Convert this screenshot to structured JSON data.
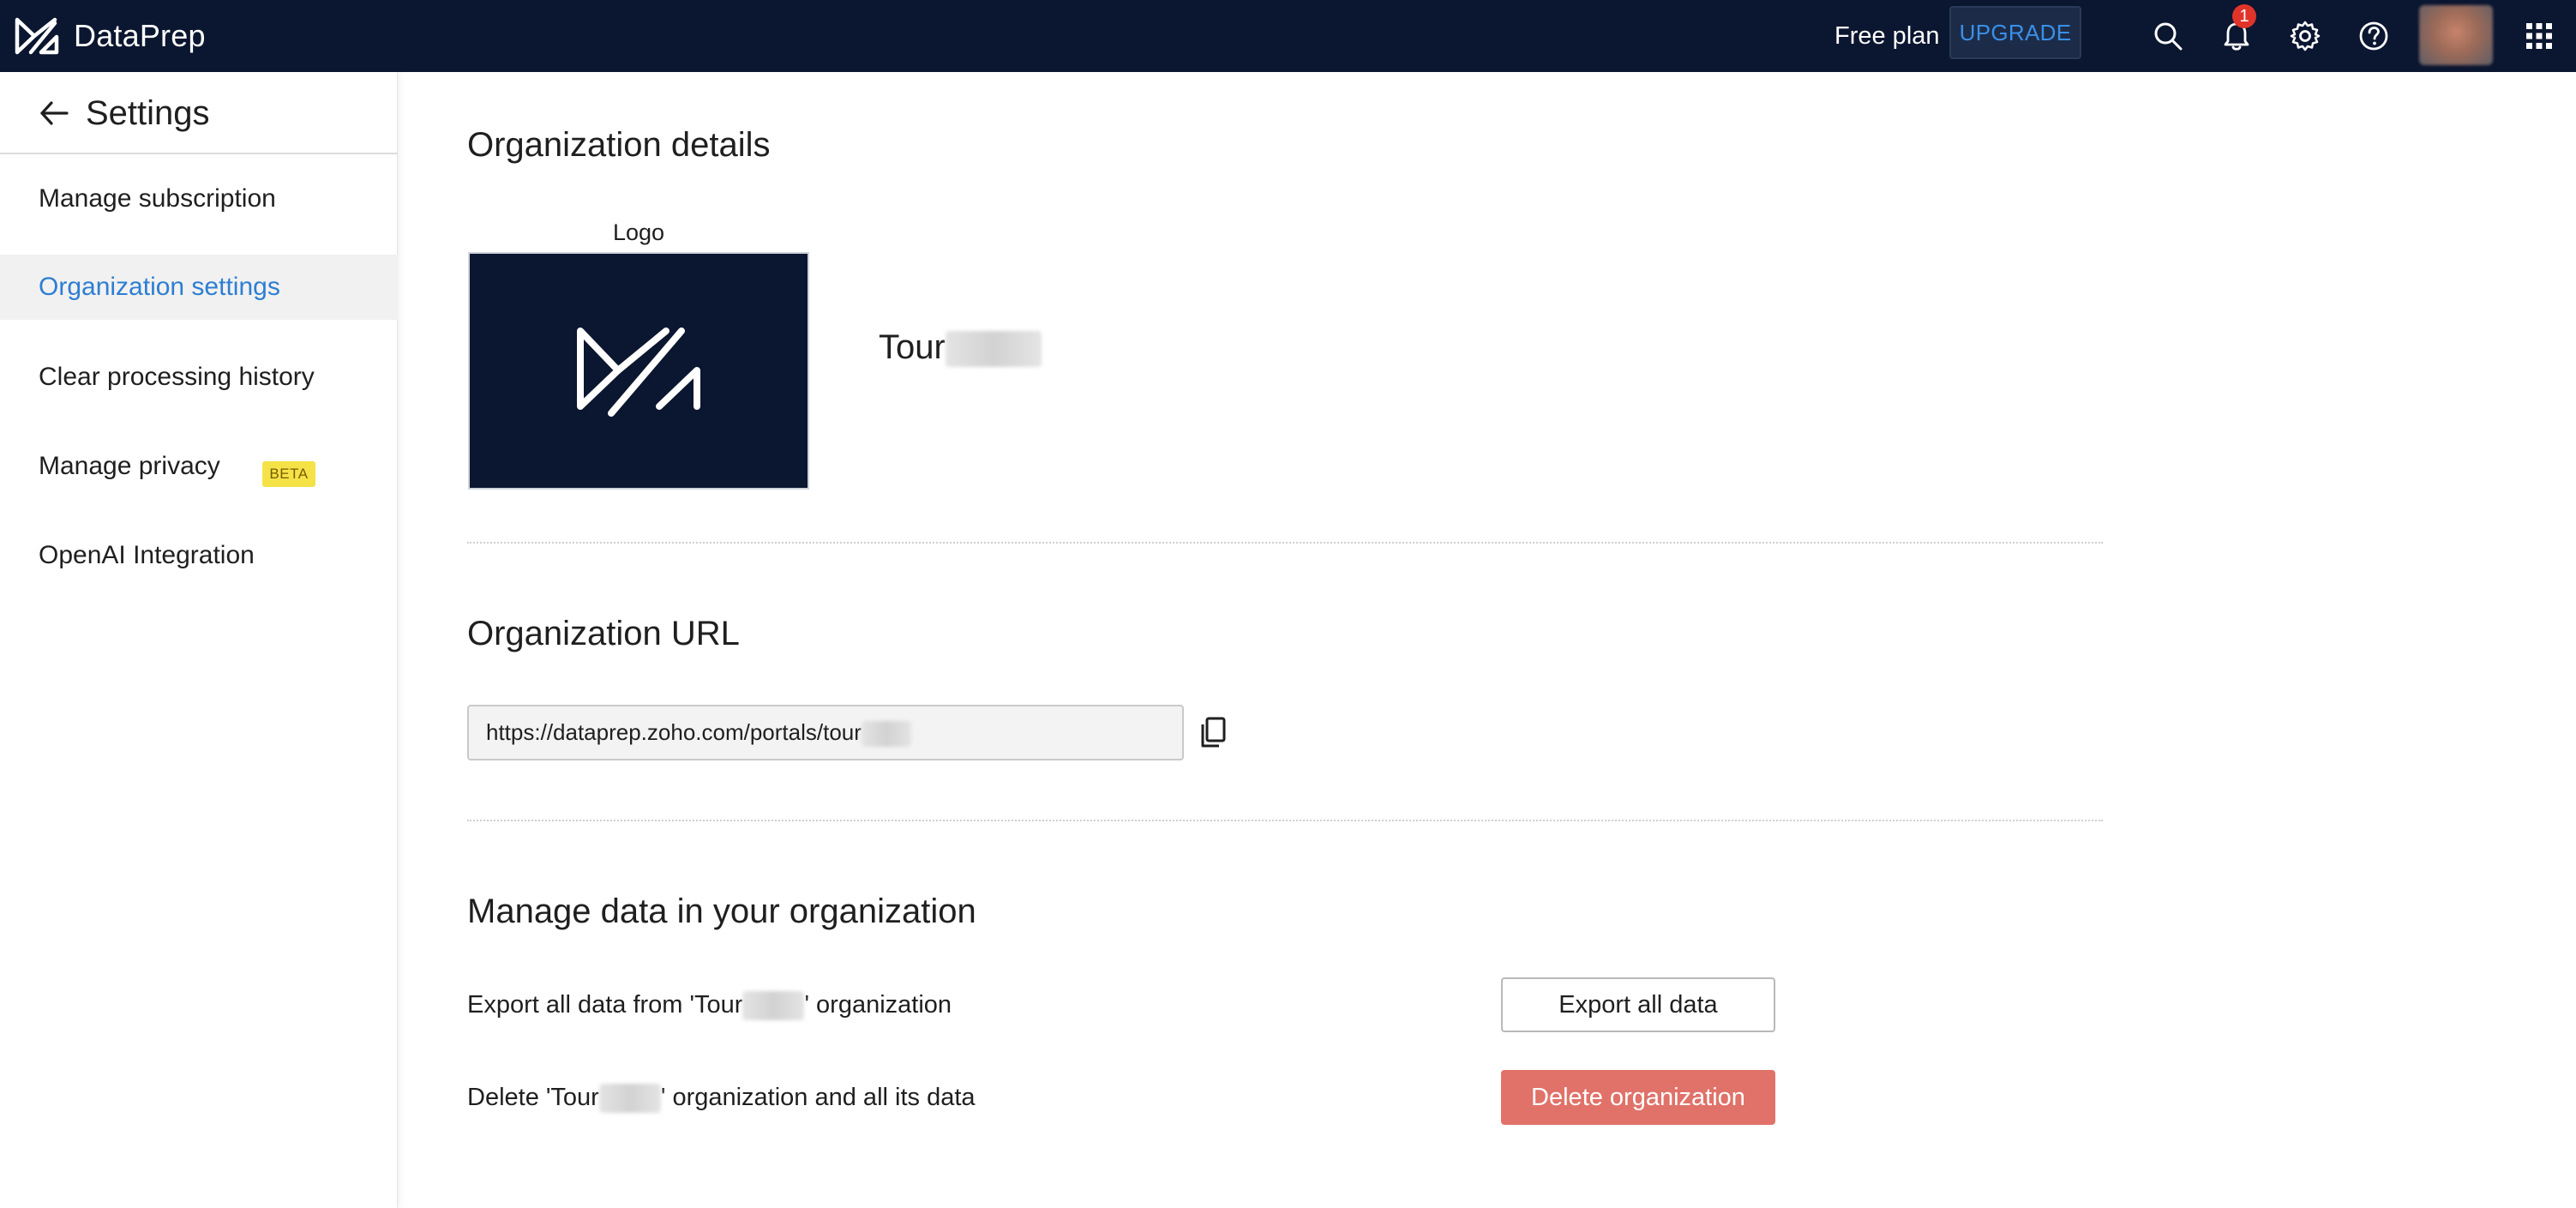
{
  "app": {
    "name": "DataPrep",
    "plan_label": "Free plan",
    "upgrade_label": "UPGRADE",
    "notification_count": "1",
    "colors": {
      "topbar": "#0b1630",
      "accent": "#2d7ed2",
      "danger": "#e07269",
      "beta": "#f5e247"
    },
    "icons": [
      "dataprep-logo-icon",
      "search-icon",
      "bell-icon",
      "gear-icon",
      "help-icon",
      "avatar",
      "app-grid-icon"
    ]
  },
  "sidebar": {
    "title": "Settings",
    "back_icon": "back-arrow-icon",
    "items": [
      {
        "label": "Manage subscription",
        "active": false
      },
      {
        "label": "Organization settings",
        "active": true
      },
      {
        "label": "Clear processing history",
        "active": false
      },
      {
        "label": "Manage privacy",
        "active": false
      },
      {
        "label": "OpenAI Integration",
        "active": false,
        "badge": "BETA"
      }
    ]
  },
  "org_details": {
    "title": "Organization details",
    "logo_label": "Logo",
    "org_name": "Tour"
  },
  "org_url": {
    "title": "Organization URL",
    "value": "https://dataprep.zoho.com/portals/tour",
    "copy_icon": "copy-icon"
  },
  "manage_data": {
    "title": "Manage data in your organization",
    "export_prefix": "Export all data from 'Tour",
    "export_suffix": "' organization",
    "export_button": "Export all data",
    "delete_prefix": "Delete 'Tour",
    "delete_suffix": "' organization and all its data",
    "delete_button": "Delete organization"
  }
}
